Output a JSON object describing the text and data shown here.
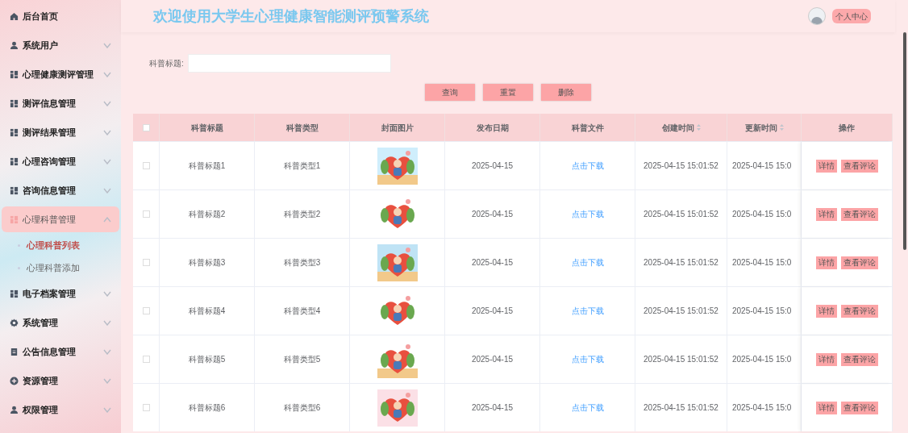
{
  "sidebar": {
    "items": [
      {
        "label": "后台首页",
        "kind": "home",
        "selected": false
      },
      {
        "label": "系统用户",
        "kind": "user",
        "selected": false,
        "expanded": false
      },
      {
        "label": "心理健康测评管理",
        "kind": "grid",
        "selected": false,
        "expanded": false
      },
      {
        "label": "测评信息管理",
        "kind": "grid",
        "selected": false,
        "expanded": false
      },
      {
        "label": "测评结果管理",
        "kind": "grid",
        "selected": false,
        "expanded": false
      },
      {
        "label": "心理咨询管理",
        "kind": "grid",
        "selected": false,
        "expanded": false
      },
      {
        "label": "咨询信息管理",
        "kind": "grid",
        "selected": false,
        "expanded": false
      },
      {
        "label": "心理科普管理",
        "kind": "grid",
        "selected": true,
        "expanded": true,
        "children": [
          {
            "label": "心理科普列表",
            "selected": true
          },
          {
            "label": "心理科普添加",
            "selected": false
          }
        ]
      },
      {
        "label": "电子档案管理",
        "kind": "grid",
        "selected": false,
        "expanded": false
      },
      {
        "label": "系统管理",
        "kind": "gear",
        "selected": false,
        "expanded": false
      },
      {
        "label": "公告信息管理",
        "kind": "doc",
        "selected": false,
        "expanded": false
      },
      {
        "label": "资源管理",
        "kind": "plus",
        "selected": false,
        "expanded": false
      },
      {
        "label": "权限管理",
        "kind": "user",
        "selected": false,
        "expanded": false
      }
    ]
  },
  "header": {
    "title": "欢迎使用大学生心理健康智能测评预警系统",
    "user_menu": "个人中心"
  },
  "search": {
    "label": "科普标题:"
  },
  "buttons": [
    "查询",
    "重置",
    "删除"
  ],
  "table": {
    "select_all": false,
    "columns": [
      {
        "label": "科普标题",
        "sortable": false
      },
      {
        "label": "科普类型",
        "sortable": false
      },
      {
        "label": "封面图片",
        "sortable": false
      },
      {
        "label": "发布日期",
        "sortable": false
      },
      {
        "label": "科普文件",
        "sortable": false
      },
      {
        "label": "创建时间",
        "sortable": true
      },
      {
        "label": "更新时间",
        "sortable": true
      },
      {
        "label": "操作",
        "sortable": false
      }
    ],
    "rows": [
      {
        "checked": false,
        "title": "科普标题1",
        "type": "科普类型1",
        "date": "2025-04-15",
        "file": "点击下载",
        "created": "2025-04-15 15:01:52",
        "updated": "2025-04-15 15:0",
        "actions": [
          "详情",
          "查看评论"
        ]
      },
      {
        "checked": false,
        "title": "科普标题2",
        "type": "科普类型2",
        "date": "2025-04-15",
        "file": "点击下载",
        "created": "2025-04-15 15:01:52",
        "updated": "2025-04-15 15:0",
        "actions": [
          "详情",
          "查看评论"
        ]
      },
      {
        "checked": false,
        "title": "科普标题3",
        "type": "科普类型3",
        "date": "2025-04-15",
        "file": "点击下载",
        "created": "2025-04-15 15:01:52",
        "updated": "2025-04-15 15:0",
        "actions": [
          "详情",
          "查看评论"
        ]
      },
      {
        "checked": false,
        "title": "科普标题4",
        "type": "科普类型4",
        "date": "2025-04-15",
        "file": "点击下载",
        "created": "2025-04-15 15:01:52",
        "updated": "2025-04-15 15:0",
        "actions": [
          "详情",
          "查看评论"
        ]
      },
      {
        "checked": false,
        "title": "科普标题5",
        "type": "科普类型5",
        "date": "2025-04-15",
        "file": "点击下载",
        "created": "2025-04-15 15:01:52",
        "updated": "2025-04-15 15:0",
        "actions": [
          "详情",
          "查看评论"
        ]
      },
      {
        "checked": false,
        "title": "科普标题6",
        "type": "科普类型6",
        "date": "2025-04-15",
        "file": "点击下载",
        "created": "2025-04-15 15:01:52",
        "updated": "2025-04-15 15:0",
        "actions": [
          "详情",
          "查看评论"
        ]
      }
    ]
  }
}
